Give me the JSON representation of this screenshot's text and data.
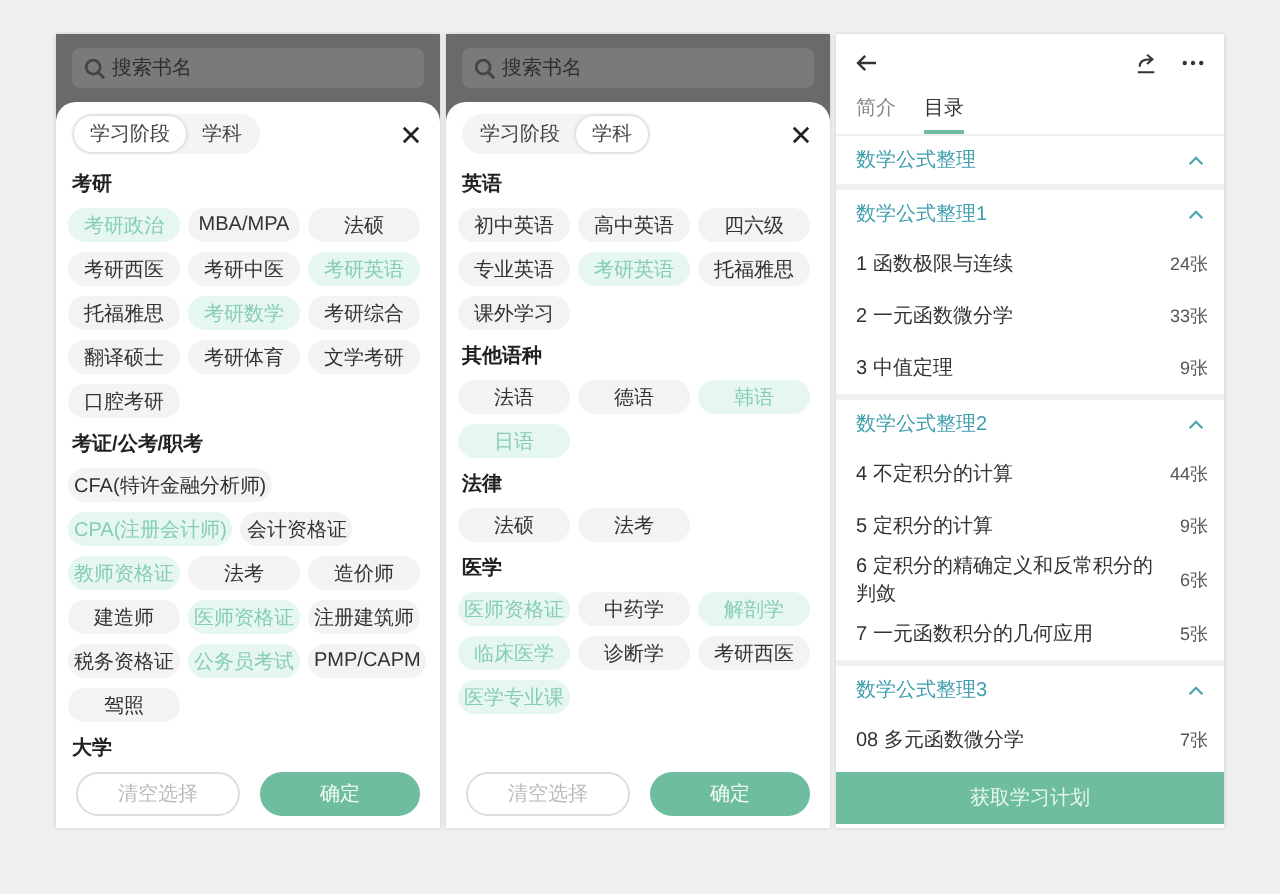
{
  "panels": [
    {
      "kind": "filter",
      "search": {
        "placeholder": "搜索书名"
      },
      "tabs": [
        {
          "label": "学习阶段",
          "selected": true
        },
        {
          "label": "学科",
          "selected": false
        }
      ],
      "sections": [
        {
          "title": "考研",
          "chips": [
            {
              "label": "考研政治",
              "selected": true
            },
            {
              "label": "MBA/MPA",
              "selected": false
            },
            {
              "label": "法硕",
              "selected": false
            },
            {
              "label": "考研西医",
              "selected": false
            },
            {
              "label": "考研中医",
              "selected": false
            },
            {
              "label": "考研英语",
              "selected": true
            },
            {
              "label": "托福雅思",
              "selected": false
            },
            {
              "label": "考研数学",
              "selected": true
            },
            {
              "label": "考研综合",
              "selected": false
            },
            {
              "label": "翻译硕士",
              "selected": false
            },
            {
              "label": "考研体育",
              "selected": false
            },
            {
              "label": "文学考研",
              "selected": false
            },
            {
              "label": "口腔考研",
              "selected": false
            }
          ]
        },
        {
          "title": "考证/公考/职考",
          "chips": [
            {
              "label": "CFA(特许金融分析师)",
              "selected": false
            },
            {
              "label": "CPA(注册会计师)",
              "selected": true
            },
            {
              "label": "会计资格证",
              "selected": false
            },
            {
              "label": "教师资格证",
              "selected": true
            },
            {
              "label": "法考",
              "selected": false
            },
            {
              "label": "造价师",
              "selected": false
            },
            {
              "label": "建造师",
              "selected": false
            },
            {
              "label": "医师资格证",
              "selected": true
            },
            {
              "label": "注册建筑师",
              "selected": false
            },
            {
              "label": "税务资格证",
              "selected": false
            },
            {
              "label": "公务员考试",
              "selected": true
            },
            {
              "label": "PMP/CAPM",
              "selected": false
            },
            {
              "label": "驾照",
              "selected": false
            }
          ]
        },
        {
          "title": "大学"
        }
      ],
      "buttons": {
        "clear": "清空选择",
        "confirm": "确定"
      }
    },
    {
      "kind": "filter",
      "search": {
        "placeholder": "搜索书名"
      },
      "tabs": [
        {
          "label": "学习阶段",
          "selected": false
        },
        {
          "label": "学科",
          "selected": true
        }
      ],
      "sections": [
        {
          "title": "英语",
          "chips": [
            {
              "label": "初中英语",
              "selected": false
            },
            {
              "label": "高中英语",
              "selected": false
            },
            {
              "label": "四六级",
              "selected": false
            },
            {
              "label": "专业英语",
              "selected": false
            },
            {
              "label": "考研英语",
              "selected": true
            },
            {
              "label": "托福雅思",
              "selected": false
            },
            {
              "label": "课外学习",
              "selected": false
            }
          ]
        },
        {
          "title": "其他语种",
          "chips": [
            {
              "label": "法语",
              "selected": false
            },
            {
              "label": "德语",
              "selected": false
            },
            {
              "label": "韩语",
              "selected": true
            },
            {
              "label": "日语",
              "selected": true
            }
          ]
        },
        {
          "title": "法律",
          "chips": [
            {
              "label": "法硕",
              "selected": false
            },
            {
              "label": "法考",
              "selected": false
            }
          ]
        },
        {
          "title": "医学",
          "chips": [
            {
              "label": "医师资格证",
              "selected": true
            },
            {
              "label": "中药学",
              "selected": false
            },
            {
              "label": "解剖学",
              "selected": true
            },
            {
              "label": "临床医学",
              "selected": true
            },
            {
              "label": "诊断学",
              "selected": false
            },
            {
              "label": "考研西医",
              "selected": false
            },
            {
              "label": "医学专业课",
              "selected": true
            }
          ]
        }
      ],
      "buttons": {
        "clear": "清空选择",
        "confirm": "确定"
      }
    },
    {
      "kind": "catalog",
      "tabs": [
        {
          "label": "简介",
          "selected": false
        },
        {
          "label": "目录",
          "selected": true
        }
      ],
      "groups": [
        {
          "title": "数学公式整理",
          "expanded": true,
          "children": [
            {
              "title": "数学公式整理1",
              "expanded": true,
              "children": [
                {
                  "label": "1 函数极限与连续",
                  "count": "24张"
                },
                {
                  "label": "2 一元函数微分学",
                  "count": "33张"
                },
                {
                  "label": "3 中值定理",
                  "count": "9张"
                }
              ]
            },
            {
              "title": "数学公式整理2",
              "expanded": true,
              "children": [
                {
                  "label": "4 不定积分的计算",
                  "count": "44张"
                },
                {
                  "label": "5 定积分的计算",
                  "count": "9张"
                },
                {
                  "label": "6 定积分的精确定义和反常积分的判敛",
                  "count": "6张"
                },
                {
                  "label": "7 一元函数积分的几何应用",
                  "count": "5张"
                }
              ]
            },
            {
              "title": "数学公式整理3",
              "expanded": true,
              "children": [
                {
                  "label": "08 多元函数微分学",
                  "count": "7张"
                }
              ]
            }
          ]
        }
      ],
      "cta": "获取学习计划"
    }
  ]
}
